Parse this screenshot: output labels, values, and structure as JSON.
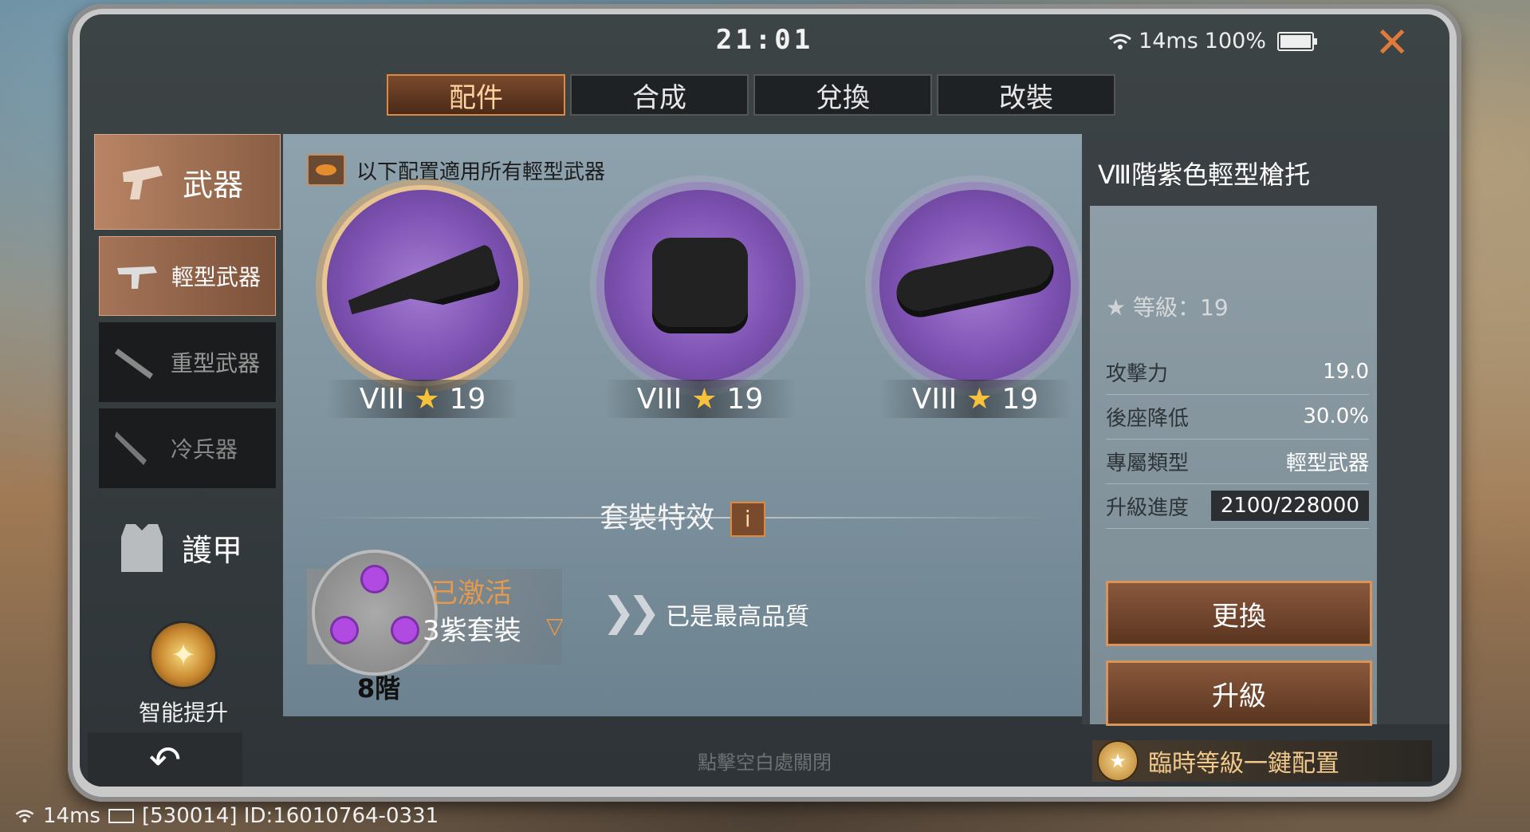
{
  "status": {
    "time": "21:01",
    "ping": "14ms",
    "battery": "100%"
  },
  "tabs": [
    {
      "label": "配件",
      "active": true
    },
    {
      "label": "合成",
      "active": false
    },
    {
      "label": "兌換",
      "active": false
    },
    {
      "label": "改裝",
      "active": false
    }
  ],
  "sidebar": {
    "weapon": "武器",
    "light": "輕型武器",
    "heavy": "重型武器",
    "melee": "冷兵器",
    "armor": "護甲",
    "smart": "智能提升"
  },
  "main": {
    "note": "以下配置適用所有輕型武器",
    "slots": [
      {
        "tier": "VIII",
        "level": "19"
      },
      {
        "tier": "VIII",
        "level": "19"
      },
      {
        "tier": "VIII",
        "level": "19"
      }
    ],
    "set_title": "套裝特效",
    "set_info": "i",
    "set_status": "已激活",
    "set_name": "3紫套裝",
    "set_grade": "8階",
    "max_quality": "已是最高品質"
  },
  "detail": {
    "title": "Ⅷ階紫色輕型槍托",
    "grade": "等級：19",
    "rows": [
      {
        "label": "攻擊力",
        "value": "19.0"
      },
      {
        "label": "後座降低",
        "value": "30.0%"
      },
      {
        "label": "專屬類型",
        "value": "輕型武器"
      },
      {
        "label": "升級進度",
        "value": "2100/228000"
      }
    ],
    "replace": "更換",
    "upgrade": "升級"
  },
  "bottom": {
    "hint": "點擊空白處關閉",
    "quick": "臨時等級一鍵配置"
  },
  "footer": {
    "ping": "14ms",
    "id": "[530014] ID:16010764-0331"
  },
  "colors": {
    "accent": "#e0893e",
    "purple": "#7e52b3"
  }
}
